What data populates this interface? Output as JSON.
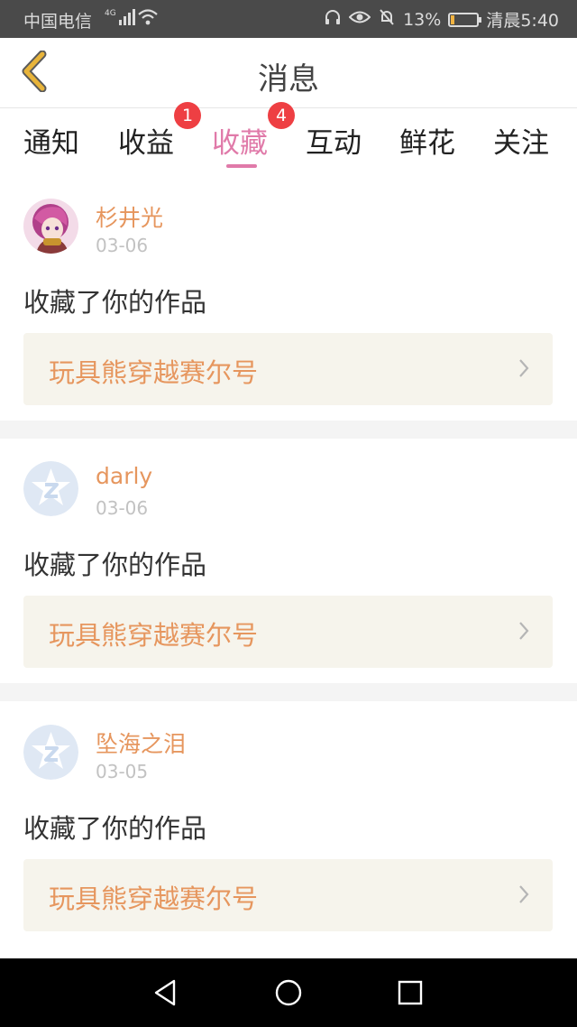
{
  "status_bar": {
    "carrier": "中国电信",
    "network": "4G",
    "battery_percent": "13%",
    "time": "清晨5:40",
    "icons": [
      "signal-icon",
      "wifi-icon",
      "headphones-icon",
      "eye-icon",
      "mute-bell-icon",
      "battery-icon"
    ]
  },
  "header": {
    "title": "消息",
    "back_icon": "chevron-left-icon"
  },
  "tabs": [
    {
      "label": "通知",
      "badge": ""
    },
    {
      "label": "收益",
      "badge": "1"
    },
    {
      "label": "收藏",
      "badge": "4",
      "active": true
    },
    {
      "label": "互动",
      "badge": ""
    },
    {
      "label": "鲜花",
      "badge": ""
    },
    {
      "label": "关注",
      "badge": ""
    }
  ],
  "messages": [
    {
      "username": "杉井光",
      "date": "03-06",
      "action": "收藏了你的作品",
      "work": "玩具熊穿越赛尔号",
      "avatar": "anime-avatar"
    },
    {
      "username": "darly",
      "date": "03-06",
      "action": "收藏了你的作品",
      "work": "玩具熊穿越赛尔号",
      "avatar": "default-qq-avatar"
    },
    {
      "username": "坠海之泪",
      "date": "03-05",
      "action": "收藏了你的作品",
      "work": "玩具熊穿越赛尔号",
      "avatar": "default-qq-avatar"
    }
  ],
  "colors": {
    "accent": "#e07aa9",
    "username": "#e6965e",
    "badge": "#ee3f43",
    "card_bg": "#f6f4ec",
    "back_arrow": "#e8b43a"
  },
  "nav_bar": {
    "icons": [
      "back-triangle-icon",
      "home-circle-icon",
      "recents-square-icon"
    ]
  }
}
